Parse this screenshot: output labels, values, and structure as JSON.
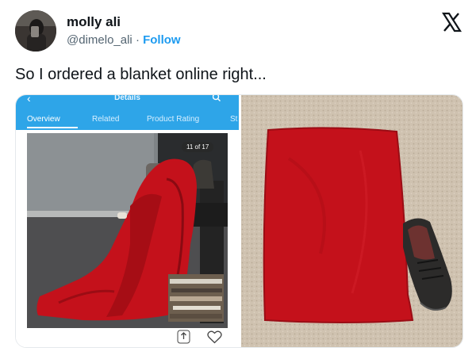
{
  "post": {
    "display_name": "molly ali",
    "handle": "@dimelo_ali",
    "separator": "·",
    "follow_label": "Follow",
    "text": "So I ordered a blanket online right..."
  },
  "left_screenshot": {
    "app_title": "Details",
    "tabs": [
      {
        "label": "Overview",
        "active": true
      },
      {
        "label": "Related",
        "active": false
      },
      {
        "label": "Product Rating",
        "active": false
      },
      {
        "label": "St",
        "active": false
      }
    ],
    "image_counter": "11 of 17",
    "icons": [
      "back-arrow-icon",
      "search-icon",
      "share-icon",
      "heart-icon"
    ]
  },
  "colors": {
    "app_bar": "#2ea5e8",
    "follow": "#1d9bf0",
    "blanket_red": "#c4111b",
    "carpet": "#cfc2b0"
  }
}
